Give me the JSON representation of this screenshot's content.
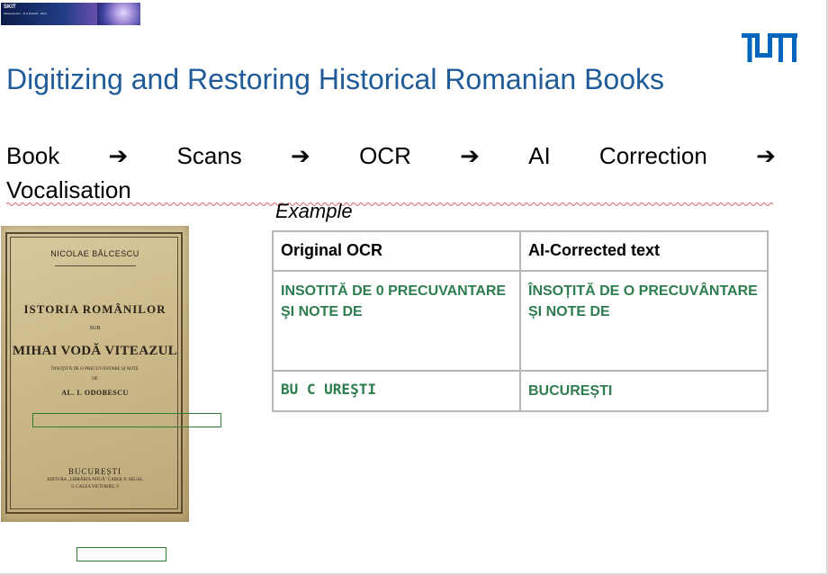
{
  "banner": {
    "title": "SKIT",
    "subtitle": "Masterstudent · AI & Robotik · 2024"
  },
  "logo": {
    "name": "tum-logo",
    "text": "TUM"
  },
  "slide": {
    "title": "Digitizing and Restoring Historical Romanian Books"
  },
  "workflow": {
    "steps": [
      "Book",
      "Scans",
      "OCR",
      "AI",
      "Correction",
      "Vocalisation"
    ],
    "arrow": "➔"
  },
  "example": {
    "label": "Example",
    "headers": [
      "Original OCR",
      "AI-Corrected text"
    ],
    "rows": [
      {
        "original": "INSOTITĂ DE 0 PRECUVANTARE ŞI NOTE DE",
        "corrected": "ÎNSOȚITĂ DE O PRECUVÂNTARE ȘI NOTE DE"
      },
      {
        "original": "BU C UREŞTI",
        "corrected": "BUCUREȘTI"
      }
    ]
  },
  "book": {
    "author": "NICOLAE BĂLCESCU",
    "title_line1": "ISTORIA ROMÂNILOR",
    "sub": "SUB",
    "title_line2": "MIHAI VODĂ VITEAZUL",
    "line": "ÎNSOȚITĂ DE O PRECUVÂNTARE ȘI NOTE",
    "de": "DE",
    "editor": "AL. I. ODOBESCU",
    "city": "BUCUREȘTI",
    "publisher1": "EDITURA „LIBRĂRIA NOUĂ\" CAROL P. SEGAL",
    "publisher2": "9, CALEA VICTORIEI, 9"
  },
  "colors": {
    "title": "#1f5b99",
    "tum_blue": "#0065bd",
    "table_text": "#2e7d4f",
    "highlight": "#2e7d32"
  }
}
